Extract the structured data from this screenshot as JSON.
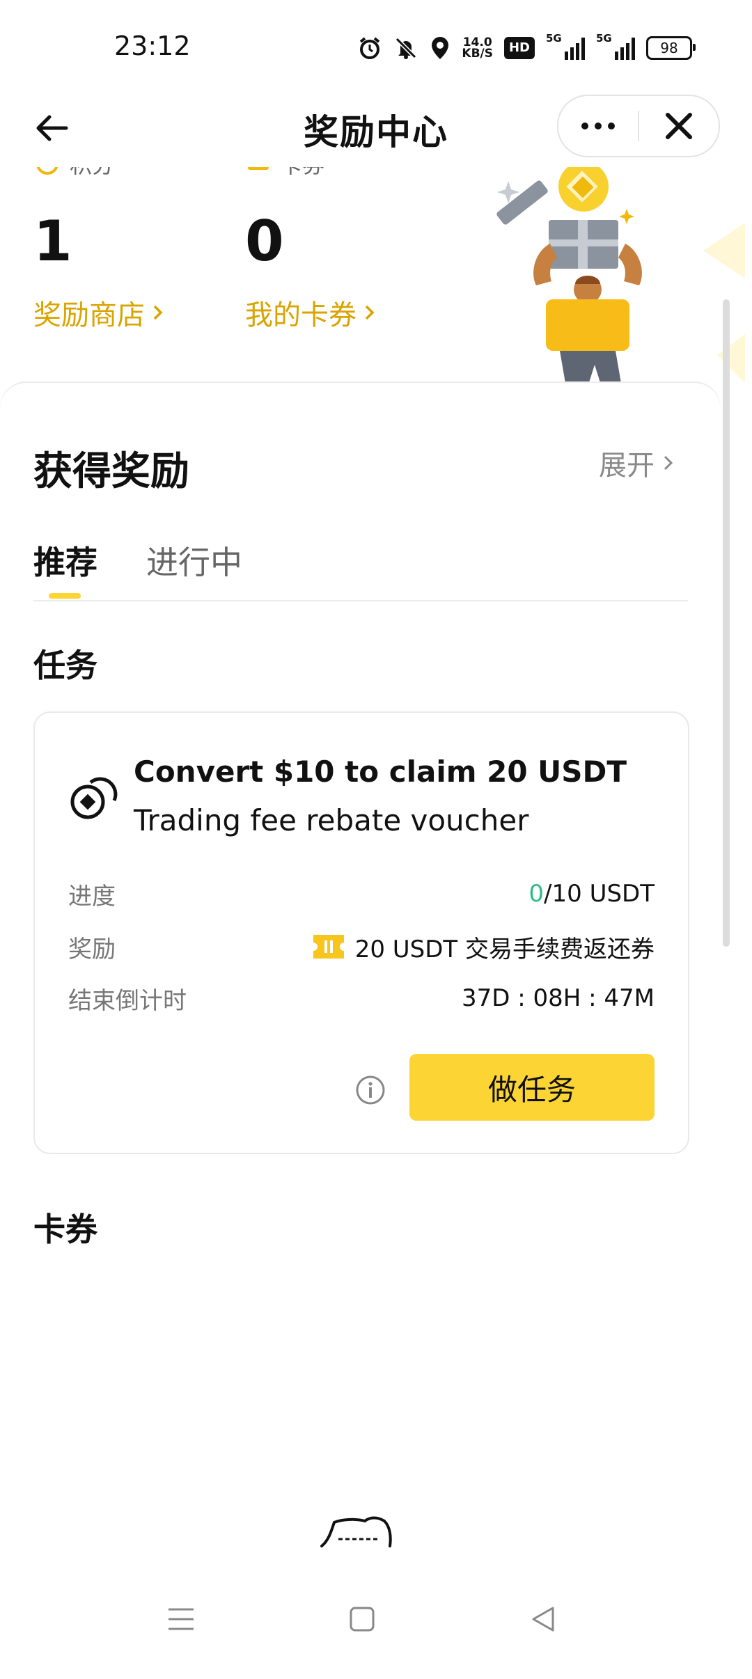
{
  "status_bar": {
    "time": "23:12",
    "net_speed_value": "14.0",
    "net_speed_unit": "KB/S",
    "hd_label": "HD",
    "signal1_label": "5G",
    "signal2_label": "5G",
    "battery": "98",
    "icons": [
      "alarm-icon",
      "mute-bell-icon",
      "location-icon",
      "hd-icon",
      "signal-icon",
      "signal-icon",
      "battery-icon"
    ]
  },
  "header": {
    "title": "奖励中心",
    "back_icon": "arrow-left-icon",
    "more_icon": "more-dots-icon",
    "close_icon": "close-icon"
  },
  "summary": {
    "points": {
      "label": "积分",
      "value": "1",
      "link": "奖励商店"
    },
    "coupons": {
      "label": "卡券",
      "value": "0",
      "link": "我的卡券"
    },
    "accent": "#d9a400"
  },
  "rewards": {
    "title": "获得奖励",
    "expand": "展开",
    "tabs": [
      {
        "label": "推荐",
        "active": true
      },
      {
        "label": "进行中",
        "active": false
      }
    ],
    "tasks_title": "任务",
    "task": {
      "title_part1": "Convert $10 to claim 20 USDT",
      "title_part2": "Trading fee rebate voucher",
      "progress_label": "进度",
      "progress_current": "0",
      "progress_rest": "/10 USDT",
      "reward_label": "奖励",
      "reward_value": "20 USDT 交易手续费返还券",
      "countdown_label": "结束倒计时",
      "countdown_value": "37D : 08H : 47M",
      "button": "做任务"
    },
    "coupons_title": "卡券"
  },
  "colors": {
    "brand_yellow": "#fcd535",
    "positive_green": "#2ebd85"
  }
}
